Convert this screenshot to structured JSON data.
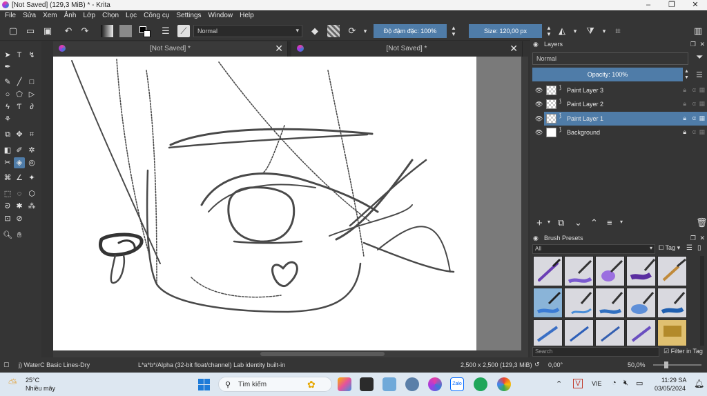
{
  "window": {
    "title": "[Not Saved]  (129,3 MiB)  * - Krita",
    "controls": [
      "–",
      "❐",
      "✕"
    ]
  },
  "menu": [
    "File",
    "Sửa",
    "Xem",
    "Ảnh",
    "Lớp",
    "Chọn",
    "Lọc",
    "Công cụ",
    "Settings",
    "Window",
    "Help"
  ],
  "toolbar": {
    "blend_mode": "Normal",
    "opacity_label": "Độ đậm đặc: 100%",
    "size_label": "Size: 120,00 px"
  },
  "tabs": [
    {
      "label": "[Not Saved]  *"
    },
    {
      "label": "[Not Saved]  *"
    }
  ],
  "layers_panel": {
    "title": "Layers",
    "blend_mode": "Normal",
    "opacity": "Opacity:  100%",
    "layers": [
      {
        "name": "Paint Layer 3",
        "selected": false
      },
      {
        "name": "Paint Layer 2",
        "selected": false
      },
      {
        "name": "Paint Layer 1",
        "selected": true
      },
      {
        "name": "Background",
        "selected": false
      }
    ]
  },
  "brush_panel": {
    "title": "Brush Presets",
    "filter": "All",
    "tag_label": "Tag",
    "search_placeholder": "Search",
    "filter_in_tag": "Filter in Tag"
  },
  "statusbar": {
    "brush_name": "j) WaterC Basic Lines-Dry",
    "color_profile": "L*a*b*/Alpha (32-bit float/channel)  Lab identity built-in",
    "dimensions": "2,500 x 2,500 (129,3 MiB)",
    "rotation": "0,00°",
    "zoom": "50,0%"
  },
  "taskbar": {
    "temperature": "25°C",
    "weather": "Nhiều mây",
    "search_placeholder": "Tìm kiếm",
    "language": "VIE",
    "time": "11:29 SA",
    "date": "03/05/2024"
  },
  "colors": {
    "accent": "#4f7ca8",
    "panel_bg": "#353535",
    "canvas_bg": "#ffffff"
  }
}
